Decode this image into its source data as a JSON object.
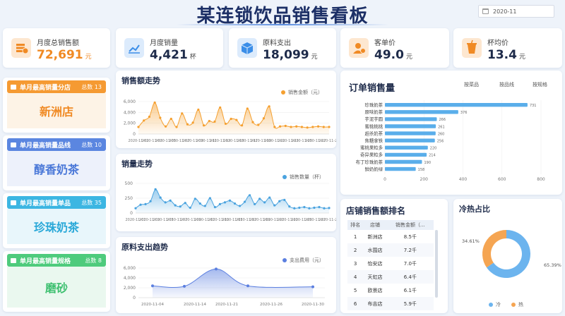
{
  "header": {
    "title": "某连锁饮品销售看板",
    "date": "2020-11"
  },
  "kpis": [
    {
      "label": "月度总销售额",
      "value": "72,691",
      "unit": "元",
      "color": "#f08a24",
      "icon": "sales-icon"
    },
    {
      "label": "月度销量",
      "value": "4,421",
      "unit": "杯",
      "color": "#3b8ee8",
      "icon": "chart-icon"
    },
    {
      "label": "原料支出",
      "value": "18,099",
      "unit": "元",
      "color": "#3b8ee8",
      "icon": "box-icon"
    },
    {
      "label": "客单价",
      "value": "49.0",
      "unit": "元",
      "color": "#f08a24",
      "icon": "user-icon"
    },
    {
      "label": "杯均价",
      "value": "13.4",
      "unit": "元",
      "color": "#f08a24",
      "icon": "cup-icon"
    }
  ],
  "left_cards": [
    {
      "title": "单月最高销量分店",
      "count": "总数 13",
      "value": "新洲店",
      "color": "#f08a24",
      "bg": "#fdf3e6",
      "head": "#f59a32"
    },
    {
      "title": "单月最高销量品线",
      "count": "总数 10",
      "value": "醇香奶茶",
      "color": "#4a78d8",
      "bg": "#edf1fb",
      "head": "#5b86e0"
    },
    {
      "title": "单月最高销量单品",
      "count": "总数 35",
      "value": "珍珠奶茶",
      "color": "#29a8d8",
      "bg": "#e8f6fb",
      "head": "#3cb6e2"
    },
    {
      "title": "单月最高销量规格",
      "count": "总数 8",
      "value": "磨砂",
      "color": "#3ec070",
      "bg": "#eaf8ef",
      "head": "#4ecb7c"
    }
  ],
  "sales_trend": {
    "title": "销售额走势",
    "legend": "销售金额（元）",
    "y_ticks": [
      "6,000",
      "4,000",
      "2,000",
      "0"
    ],
    "x_ticks": [
      "2020-11-01",
      "2020-11-03",
      "2020-11-05",
      "2020-11-07",
      "2020-11-09",
      "2020-11-11",
      "2020-11-13",
      "2020-11-15",
      "2020-11-17",
      "2020-11-19",
      "2020-11-21",
      "2020-11-23",
      "2020-11-25",
      "2020-11-27",
      "2020-11-29"
    ]
  },
  "volume_trend": {
    "title": "销量走势",
    "legend": "销售数量（杯）",
    "y_ticks": [
      "500",
      "250",
      "0"
    ],
    "x_ticks": [
      "2020-11-01",
      "2020-11-03",
      "2020-11-05",
      "2020-11-07",
      "2020-11-09",
      "2020-11-11",
      "2020-11-13",
      "2020-11-15",
      "2020-11-17",
      "2020-11-19",
      "2020-11-21",
      "2020-11-23",
      "2020-11-25",
      "2020-11-27",
      "2020-11-29"
    ]
  },
  "cost_trend": {
    "title": "原料支出趋势",
    "legend": "支出费用（元）",
    "y_ticks": [
      "6,000",
      "4,000",
      "2,000",
      "0"
    ],
    "x_ticks": [
      "2020-11-04",
      "2020-11-14",
      "2020-11-21",
      "2020-11-26",
      "2020-11-30"
    ]
  },
  "orders": {
    "title": "订单销售量",
    "tabs": [
      "按菜品",
      "按品线",
      "按规格"
    ],
    "x_ticks": [
      "0",
      "200",
      "400",
      "600",
      "800"
    ]
  },
  "ranking": {
    "title": "店铺销售额排名",
    "columns": [
      "排名",
      "店铺",
      "销售金额（..."
    ],
    "rows": [
      [
        "1",
        "新洲店",
        "8.5千"
      ],
      [
        "2",
        "水围店",
        "7.2千"
      ],
      [
        "3",
        "怡安店",
        "7.0千"
      ],
      [
        "4",
        "天虹店",
        "6.4千"
      ],
      [
        "5",
        "欧景店",
        "6.1千"
      ],
      [
        "6",
        "布吉店",
        "5.9千"
      ]
    ]
  },
  "hotcold": {
    "title": "冷热占比",
    "legend": [
      "冷",
      "热"
    ],
    "colors": [
      "#6cb4ee",
      "#f5a552"
    ]
  },
  "chart_data": [
    {
      "type": "area",
      "title": "销售额走势",
      "ylim": [
        0,
        6000
      ],
      "series": [
        {
          "name": "销售金额（元）",
          "color": "#f5a030",
          "values": [
            1300,
            2500,
            3200,
            5800,
            3000,
            1400,
            2800,
            1300,
            3800,
            1800,
            2100,
            4500,
            1600,
            2400,
            2300,
            4900,
            1900,
            2800,
            2600,
            1600,
            4700,
            2200,
            1700,
            2900,
            5100,
            1300,
            1400,
            1500,
            1300,
            1400,
            1300,
            1200,
            1300,
            1400,
            1300,
            1300
          ]
        }
      ]
    },
    {
      "type": "area",
      "title": "销量走势",
      "ylim": [
        0,
        500
      ],
      "series": [
        {
          "name": "销售数量（杯）",
          "color": "#4aa3df",
          "values": [
            80,
            140,
            150,
            200,
            400,
            260,
            180,
            210,
            130,
            110,
            170,
            90,
            240,
            160,
            120,
            250,
            100,
            150,
            180,
            210,
            160,
            120,
            190,
            300,
            150,
            240,
            180,
            260,
            130,
            200,
            220,
            110,
            80,
            90,
            100,
            80,
            90,
            100,
            80,
            85
          ]
        }
      ]
    },
    {
      "type": "area",
      "title": "原料支出趋势",
      "ylim": [
        0,
        6000
      ],
      "x": [
        "2020-11-04",
        "2020-11-14",
        "2020-11-21",
        "2020-11-26",
        "2020-11-30"
      ],
      "series": [
        {
          "name": "支出费用（元）",
          "color": "#5b7fe0",
          "values": [
            2400,
            2300,
            5800,
            2400,
            2200
          ]
        }
      ]
    },
    {
      "type": "bar",
      "title": "订单销售量",
      "xlim": [
        0,
        800
      ],
      "categories": [
        "珍珠奶茶",
        "原味奶茶",
        "芋泥芋圆",
        "蜜桃桃桃",
        "超杀奶茶",
        "焦糖拿铁",
        "蜜桃果粒多",
        "奇异果粒多",
        "布丁珍珠奶茶",
        "鲜奶奶绿"
      ],
      "values": [
        731,
        376,
        266,
        261,
        260,
        256,
        220,
        214,
        190,
        158
      ],
      "color": "#5aaeea"
    },
    {
      "type": "pie",
      "title": "冷热占比",
      "categories": [
        "冷",
        "热"
      ],
      "values": [
        65.39,
        34.61
      ],
      "labels": [
        "65.39%",
        "34.61%"
      ]
    }
  ]
}
